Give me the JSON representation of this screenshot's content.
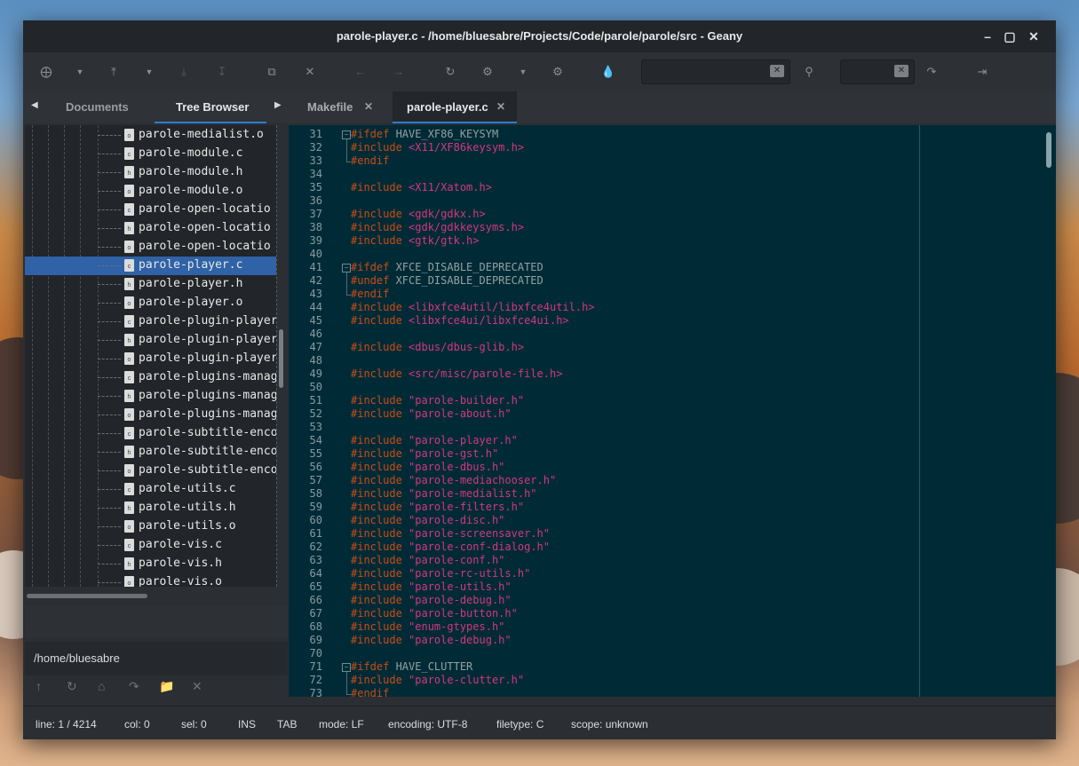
{
  "window": {
    "title": "parole-player.c - /home/bluesabre/Projects/Code/parole/parole/src - Geany"
  },
  "titlebar_icons": {
    "minimize": "minimize-icon",
    "maximize": "maximize-icon",
    "close": "close-icon"
  },
  "toolbar_icons": [
    "new-file-icon",
    "dropdown-arrow-icon",
    "open-file-icon",
    "dropdown-arrow-icon",
    "save-icon",
    "save-all-icon",
    "revert-icon",
    "close-file-icon",
    "back-icon",
    "forward-icon",
    "reload-icon",
    "compile-icon",
    "dropdown-arrow-icon",
    "build-icon",
    "color-picker-icon",
    "clear-search-icon",
    "search-icon",
    "clear-goto-icon",
    "jump-to-line-icon",
    "quit-icon"
  ],
  "sidebar": {
    "tabs": [
      {
        "label": "Documents",
        "active": false
      },
      {
        "label": "Tree Browser",
        "active": true
      }
    ],
    "files": [
      {
        "name": "parole-medialist.o",
        "ext": "o"
      },
      {
        "name": "parole-module.c",
        "ext": "c"
      },
      {
        "name": "parole-module.h",
        "ext": "h"
      },
      {
        "name": "parole-module.o",
        "ext": "o"
      },
      {
        "name": "parole-open-locatio",
        "ext": "c"
      },
      {
        "name": "parole-open-locatio",
        "ext": "h"
      },
      {
        "name": "parole-open-locatio",
        "ext": "o"
      },
      {
        "name": "parole-player.c",
        "ext": "c",
        "selected": true
      },
      {
        "name": "parole-player.h",
        "ext": "h"
      },
      {
        "name": "parole-player.o",
        "ext": "o"
      },
      {
        "name": "parole-plugin-player",
        "ext": "c"
      },
      {
        "name": "parole-plugin-player",
        "ext": "h"
      },
      {
        "name": "parole-plugin-player",
        "ext": "o"
      },
      {
        "name": "parole-plugins-manag",
        "ext": "c"
      },
      {
        "name": "parole-plugins-manag",
        "ext": "h"
      },
      {
        "name": "parole-plugins-manag",
        "ext": "o"
      },
      {
        "name": "parole-subtitle-enco",
        "ext": "c"
      },
      {
        "name": "parole-subtitle-enco",
        "ext": "h"
      },
      {
        "name": "parole-subtitle-enco",
        "ext": "o"
      },
      {
        "name": "parole-utils.c",
        "ext": "c"
      },
      {
        "name": "parole-utils.h",
        "ext": "h"
      },
      {
        "name": "parole-utils.o",
        "ext": "o"
      },
      {
        "name": "parole-vis.c",
        "ext": "c"
      },
      {
        "name": "parole-vis.h",
        "ext": "h"
      },
      {
        "name": "parole-vis.o",
        "ext": "o"
      }
    ],
    "path": "/home/bluesabre",
    "bottom_icons": [
      "go-up-icon",
      "refresh-icon",
      "home-icon",
      "set-path-icon",
      "folder-icon",
      "clear-icon"
    ]
  },
  "editor": {
    "tabs": [
      {
        "label": "Makefile",
        "active": false
      },
      {
        "label": "parole-player.c",
        "active": true
      }
    ],
    "lines": [
      {
        "n": "31",
        "d": "#ifdef",
        "a": " HAVE_XF86_KEYSYM",
        "fold": "start"
      },
      {
        "n": "32",
        "d": "#include",
        "a": " <X11/XF86keysym.h>",
        "t": "inc"
      },
      {
        "n": "33",
        "d": "#endif",
        "a": "",
        "fold": "end"
      },
      {
        "n": "34",
        "d": "",
        "a": ""
      },
      {
        "n": "35",
        "d": "#include",
        "a": " <X11/Xatom.h>",
        "t": "inc"
      },
      {
        "n": "36",
        "d": "",
        "a": ""
      },
      {
        "n": "37",
        "d": "#include",
        "a": " <gdk/gdkx.h>",
        "t": "inc"
      },
      {
        "n": "38",
        "d": "#include",
        "a": " <gdk/gdkkeysyms.h>",
        "t": "inc"
      },
      {
        "n": "39",
        "d": "#include",
        "a": " <gtk/gtk.h>",
        "t": "inc"
      },
      {
        "n": "40",
        "d": "",
        "a": ""
      },
      {
        "n": "41",
        "d": "#ifdef",
        "a": " XFCE_DISABLE_DEPRECATED",
        "fold": "start"
      },
      {
        "n": "42",
        "d": "#undef",
        "a": " XFCE_DISABLE_DEPRECATED"
      },
      {
        "n": "43",
        "d": "#endif",
        "a": "",
        "fold": "end"
      },
      {
        "n": "44",
        "d": "#include",
        "a": " <libxfce4util/libxfce4util.h>",
        "t": "inc"
      },
      {
        "n": "45",
        "d": "#include",
        "a": " <libxfce4ui/libxfce4ui.h>",
        "t": "inc"
      },
      {
        "n": "46",
        "d": "",
        "a": ""
      },
      {
        "n": "47",
        "d": "#include",
        "a": " <dbus/dbus-glib.h>",
        "t": "inc"
      },
      {
        "n": "48",
        "d": "",
        "a": ""
      },
      {
        "n": "49",
        "d": "#include",
        "a": " <src/misc/parole-file.h>",
        "t": "inc"
      },
      {
        "n": "50",
        "d": "",
        "a": ""
      },
      {
        "n": "51",
        "d": "#include",
        "a": " \"parole-builder.h\"",
        "t": "inc"
      },
      {
        "n": "52",
        "d": "#include",
        "a": " \"parole-about.h\"",
        "t": "inc"
      },
      {
        "n": "53",
        "d": "",
        "a": ""
      },
      {
        "n": "54",
        "d": "#include",
        "a": " \"parole-player.h\"",
        "t": "inc"
      },
      {
        "n": "55",
        "d": "#include",
        "a": " \"parole-gst.h\"",
        "t": "inc"
      },
      {
        "n": "56",
        "d": "#include",
        "a": " \"parole-dbus.h\"",
        "t": "inc"
      },
      {
        "n": "57",
        "d": "#include",
        "a": " \"parole-mediachooser.h\"",
        "t": "inc"
      },
      {
        "n": "58",
        "d": "#include",
        "a": " \"parole-medialist.h\"",
        "t": "inc"
      },
      {
        "n": "59",
        "d": "#include",
        "a": " \"parole-filters.h\"",
        "t": "inc"
      },
      {
        "n": "60",
        "d": "#include",
        "a": " \"parole-disc.h\"",
        "t": "inc"
      },
      {
        "n": "61",
        "d": "#include",
        "a": " \"parole-screensaver.h\"",
        "t": "inc"
      },
      {
        "n": "62",
        "d": "#include",
        "a": " \"parole-conf-dialog.h\"",
        "t": "inc"
      },
      {
        "n": "63",
        "d": "#include",
        "a": " \"parole-conf.h\"",
        "t": "inc"
      },
      {
        "n": "64",
        "d": "#include",
        "a": " \"parole-rc-utils.h\"",
        "t": "inc"
      },
      {
        "n": "65",
        "d": "#include",
        "a": " \"parole-utils.h\"",
        "t": "inc"
      },
      {
        "n": "66",
        "d": "#include",
        "a": " \"parole-debug.h\"",
        "t": "inc"
      },
      {
        "n": "67",
        "d": "#include",
        "a": " \"parole-button.h\"",
        "t": "inc"
      },
      {
        "n": "68",
        "d": "#include",
        "a": " \"enum-gtypes.h\"",
        "t": "inc"
      },
      {
        "n": "69",
        "d": "#include",
        "a": " \"parole-debug.h\"",
        "t": "inc"
      },
      {
        "n": "70",
        "d": "",
        "a": ""
      },
      {
        "n": "71",
        "d": "#ifdef",
        "a": " HAVE_CLUTTER",
        "fold": "start"
      },
      {
        "n": "72",
        "d": "#include",
        "a": " \"parole-clutter.h\"",
        "t": "inc"
      },
      {
        "n": "73",
        "d": "#endif",
        "a": "",
        "fold": "end"
      }
    ]
  },
  "status": {
    "line": "line: 1 / 4214",
    "col": "col: 0",
    "sel": "sel: 0",
    "ins": "INS",
    "tab": "TAB",
    "mode": "mode: LF",
    "encoding": "encoding: UTF-8",
    "filetype": "filetype: C",
    "scope": "scope: unknown"
  },
  "colors": {
    "editor_bg": "#002b36",
    "keyword": "#cb4b16",
    "include": "#d33682",
    "selection": "#2f62a6",
    "accent": "#2f7dd1"
  }
}
